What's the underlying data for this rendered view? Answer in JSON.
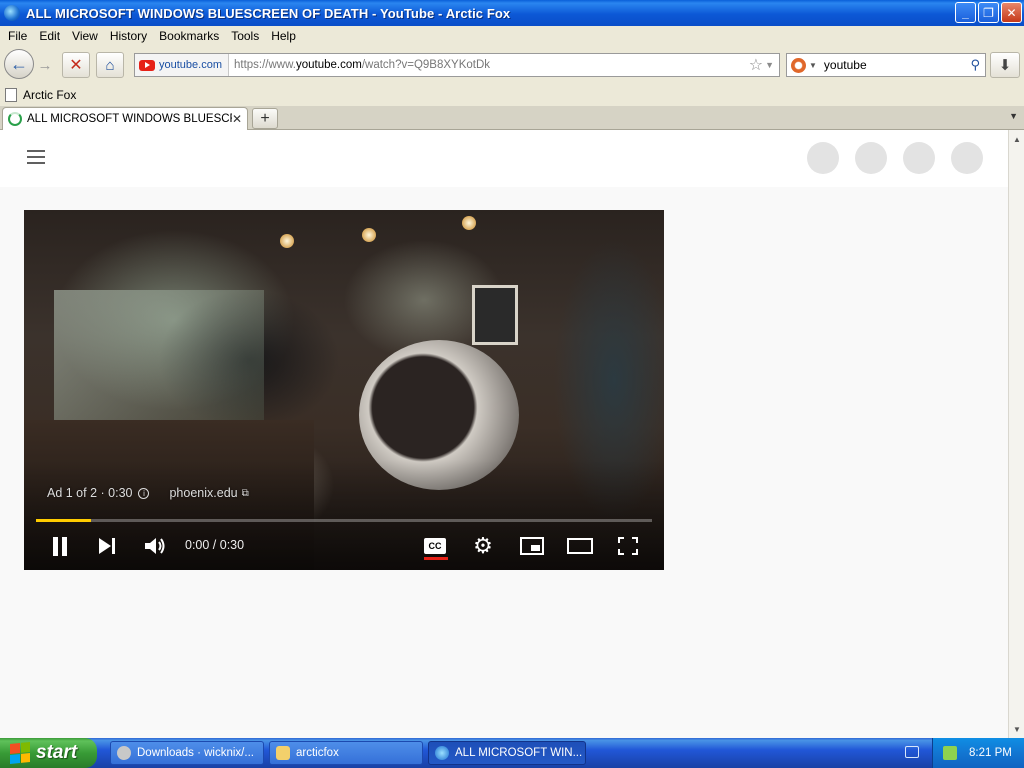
{
  "window": {
    "title": "ALL MICROSOFT WINDOWS BLUESCREEN OF DEATH - YouTube - Arctic Fox",
    "minimize": "_",
    "maximize": "❐",
    "close": "✕"
  },
  "menu": [
    "File",
    "Edit",
    "View",
    "History",
    "Bookmarks",
    "Tools",
    "Help"
  ],
  "nav": {
    "site_domain": "youtube.com",
    "url_prefix": "https://www.",
    "url_host": "youtube.com",
    "url_path": "/watch?v=Q9B8XYKotDk",
    "search_value": "youtube"
  },
  "bookmarks": {
    "items": [
      "Arctic Fox"
    ]
  },
  "tabs": [
    {
      "label": "ALL MICROSOFT WINDOWS BLUESCREE...",
      "loading": true
    }
  ],
  "newtab_label": "+",
  "player": {
    "ad_label": "Ad 1 of 2 · 0:30",
    "advertiser": "phoenix.edu",
    "time_display": "0:00 / 0:30",
    "cc_label": "CC",
    "progress": 0.09,
    "progress_color": "#ffcc00"
  },
  "taskbar": {
    "start_label": "start",
    "tasks": [
      {
        "label": "Downloads · wicknix/...",
        "active": false
      },
      {
        "label": "arcticfox",
        "active": false
      },
      {
        "label": "ALL MICROSOFT WIN...",
        "active": true
      }
    ],
    "clock": "8:21 PM"
  },
  "colors": {
    "youtube_red": "#e62117",
    "xp_blue": "#245edb",
    "start_green": "#3c9b38"
  }
}
